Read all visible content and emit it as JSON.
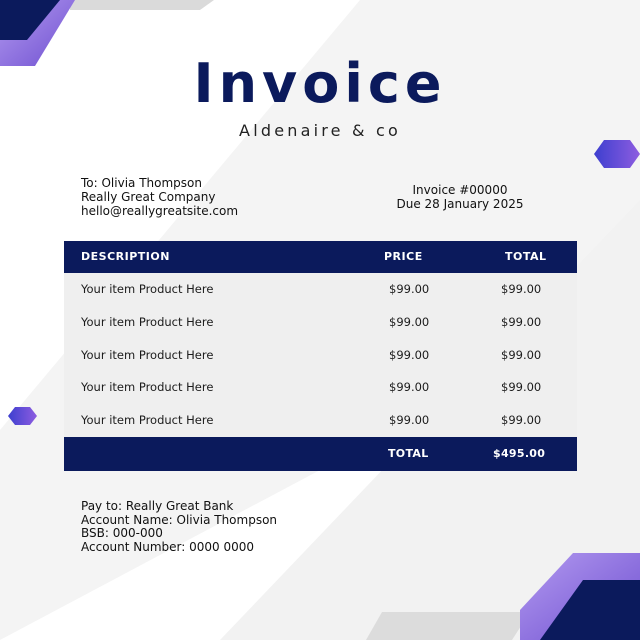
{
  "header": {
    "title": "Invoice",
    "company": "Aldenaire & co"
  },
  "bill_to": {
    "line1": "To: Olivia Thompson",
    "line2": "Really Great Company",
    "line3": "hello@reallygreatsite.com"
  },
  "invoice": {
    "number": "Invoice #00000",
    "due": "Due 28 January 2025"
  },
  "table": {
    "headers": {
      "description": "DESCRIPTION",
      "price": "PRICE",
      "total": "TOTAL"
    },
    "rows": [
      {
        "description": "Your item Product Here",
        "price": "$99.00",
        "total": "$99.00"
      },
      {
        "description": "Your item Product Here",
        "price": "$99.00",
        "total": "$99.00"
      },
      {
        "description": "Your item Product Here",
        "price": "$99.00",
        "total": "$99.00"
      },
      {
        "description": "Your item Product Here",
        "price": "$99.00",
        "total": "$99.00"
      },
      {
        "description": "Your item Product Here",
        "price": "$99.00",
        "total": "$99.00"
      }
    ],
    "footer": {
      "label": "TOTAL",
      "total": "$495.00"
    }
  },
  "payment": {
    "line1": "Pay to: Really Great Bank",
    "line2": "Account Name: Olivia Thompson",
    "line3": "BSB: 000-000",
    "line4": "Account Number: 0000 0000"
  },
  "colors": {
    "navy": "#0b1a5c",
    "purple": "#8f6fdc",
    "light_gray": "#f3f3f3"
  }
}
